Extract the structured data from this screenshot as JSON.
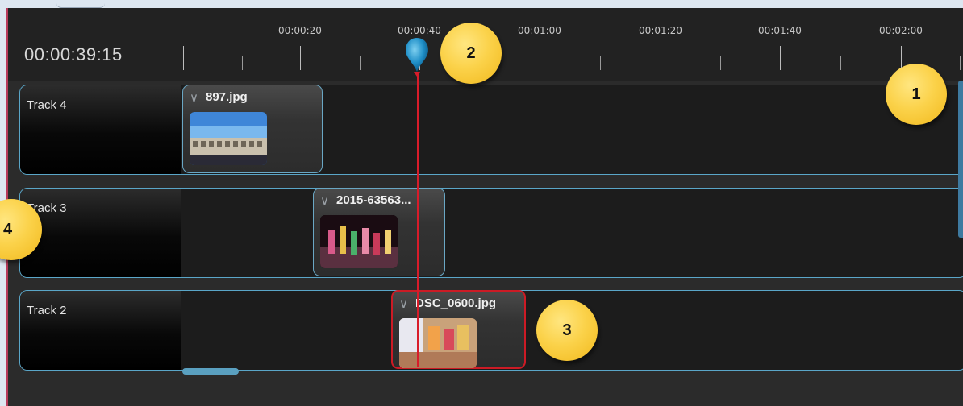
{
  "timeline": {
    "timecode": "00:00:39:15",
    "ruler_labels": [
      "00:00:20",
      "00:00:40",
      "00:01:00",
      "00:01:20",
      "00:01:40",
      "00:02:00"
    ]
  },
  "tracks": [
    {
      "name": "Track 4",
      "clip": {
        "name": "897.jpg",
        "selected": false
      }
    },
    {
      "name": "Track 3",
      "clip": {
        "name": "2015-63563...",
        "selected": false
      }
    },
    {
      "name": "Track 2",
      "clip": {
        "name": "DSC_0600.jpg",
        "selected": true
      }
    }
  ],
  "callouts": [
    "1",
    "2",
    "3",
    "4"
  ],
  "colors": {
    "playhead": "#d81c2a",
    "track_border": "#5aa6c8",
    "callout": "#fbd24a",
    "selected_clip_border": "#cc1b25"
  },
  "icons": {
    "playhead": "playhead-marker-icon",
    "clip_menu": "chevron-down-icon"
  }
}
